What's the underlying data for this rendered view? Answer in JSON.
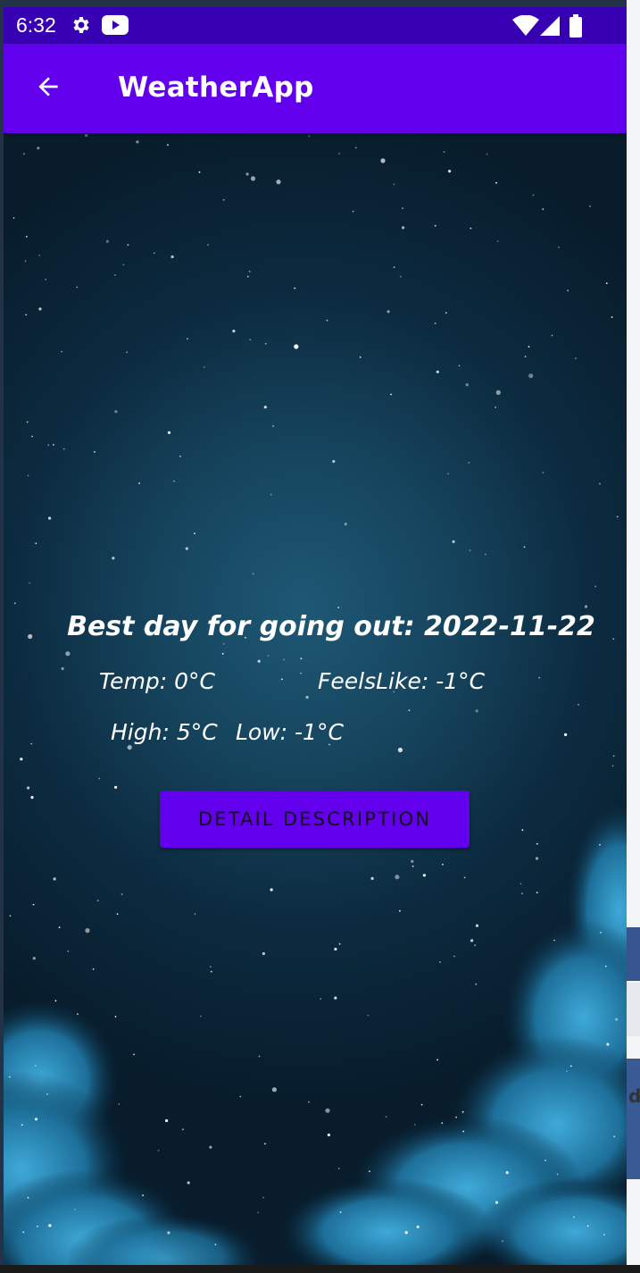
{
  "status_bar": {
    "time": "6:32",
    "icons": [
      "settings-icon",
      "youtube-icon",
      "wifi-icon",
      "signal-icon",
      "battery-icon"
    ]
  },
  "app_bar": {
    "title": "WeatherApp",
    "back_icon": "arrow-back-icon"
  },
  "forecast": {
    "best_day": "Best day for going out: 2022-11-22",
    "temp": "Temp: 0°C",
    "feels_like": "FeelsLike: -1°C",
    "high": "High: 5°C",
    "low": "Low: -1°C"
  },
  "actions": {
    "detail_label": "DETAIL DESCRIPTION"
  },
  "side_strip": {
    "peek_char": "d"
  },
  "colors": {
    "status_bar": "#3700b3",
    "app_bar": "#6200ee",
    "button": "#6200ee",
    "text": "#ffffff"
  }
}
